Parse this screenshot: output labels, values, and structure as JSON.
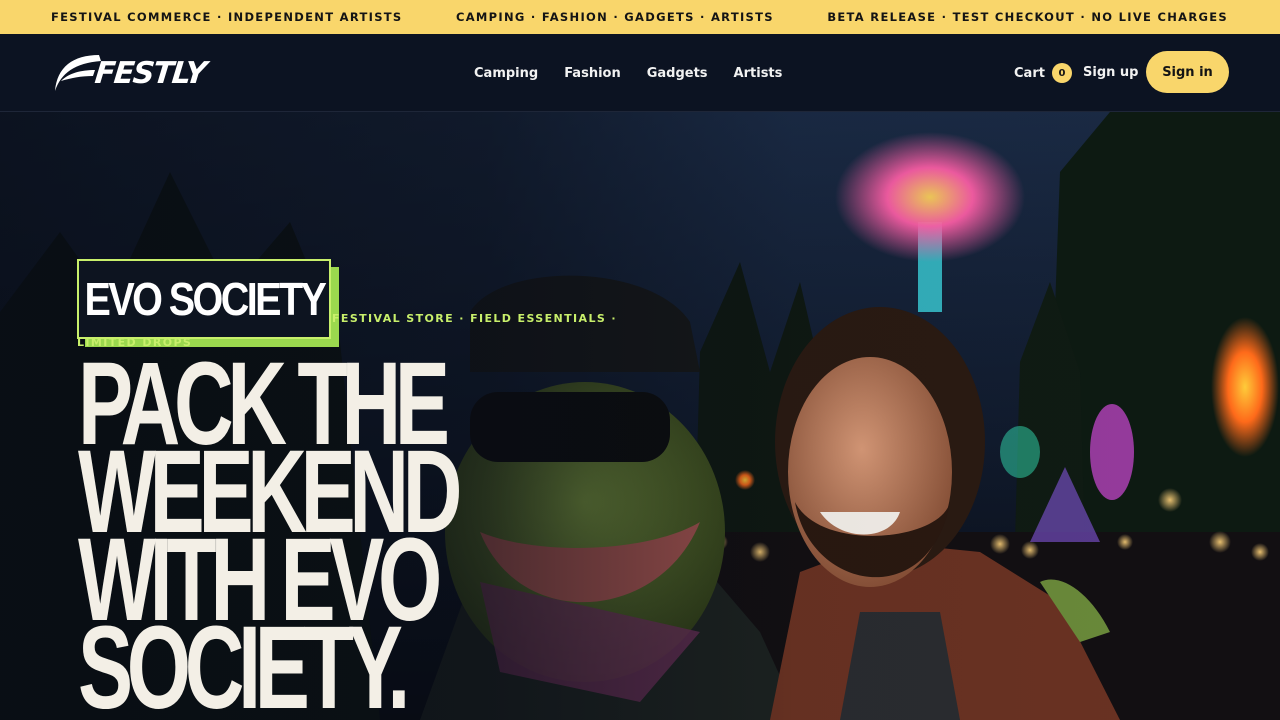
{
  "ticker": {
    "left": "FESTIVAL COMMERCE · INDEPENDENT ARTISTS",
    "center": "CAMPING · FASHION · GADGETS · ARTISTS",
    "right": "BETA RELEASE · TEST CHECKOUT · NO LIVE CHARGES"
  },
  "nav": {
    "logo_text": "FESTLY",
    "links": [
      "Camping",
      "Fashion",
      "Gadgets",
      "Artists"
    ],
    "cart_label": "Cart",
    "cart_count": "0",
    "signup_label": "Sign up",
    "signin_label": "Sign in"
  },
  "hero": {
    "brand_tag": "EVO SOCIETY",
    "eyebrow": "FESTIVAL STORE · FIELD ESSENTIALS · LIMITED DROPS",
    "headline": "PACK THE WEEKEND WITH EVO SOCIETY."
  },
  "colors": {
    "accent_yellow": "#f9d66b",
    "accent_lime": "#c8ef6b",
    "nav_bg": "#0c1322",
    "headline": "#f3efe6"
  }
}
